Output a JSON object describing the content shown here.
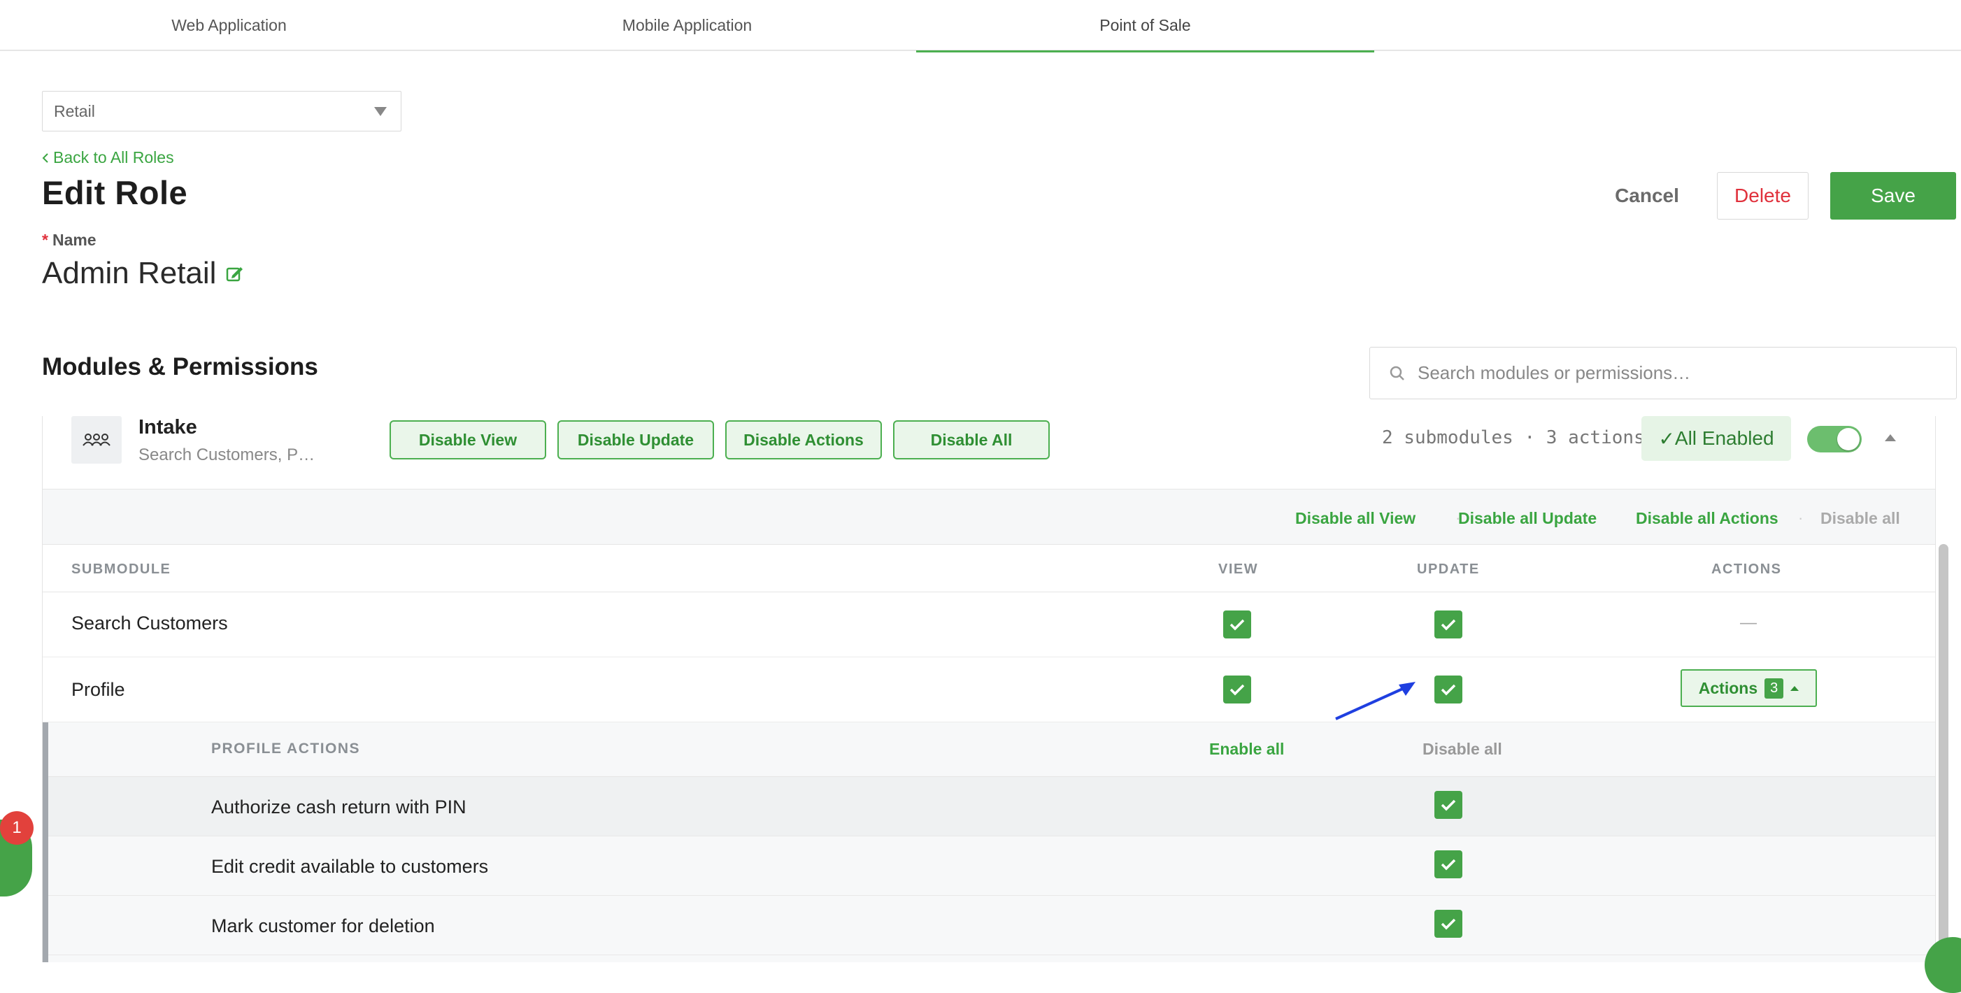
{
  "tabs": [
    {
      "label": "Web Application"
    },
    {
      "label": "Mobile Application"
    },
    {
      "label": "Point of Sale"
    }
  ],
  "store_select": {
    "value": "Retail"
  },
  "back_link": "Back to All Roles",
  "page_title": "Edit Role",
  "header_buttons": {
    "cancel": "Cancel",
    "delete": "Delete",
    "save": "Save"
  },
  "name_field": {
    "label": "Name",
    "required_mark": "*",
    "value": "Admin Retail"
  },
  "section": {
    "title": "Modules & Permissions",
    "search_placeholder": "Search modules or permissions…"
  },
  "module": {
    "name": "Intake",
    "subtitle": "Search Customers, P…",
    "buttons": [
      "Disable View",
      "Disable Update",
      "Disable Actions",
      "Disable All"
    ],
    "meta": "2 submodules · 3 actions",
    "status": "All Enabled",
    "bulk_actions": {
      "view": "Disable all View",
      "update": "Disable all Update",
      "actions": "Disable all Actions",
      "all": "Disable all"
    },
    "columns": {
      "submodule": "SUBMODULE",
      "view": "VIEW",
      "update": "UPDATE",
      "actions": "ACTIONS"
    },
    "rows": [
      {
        "label": "Search Customers",
        "view": true,
        "update": true,
        "actions": "—"
      },
      {
        "label": "Profile",
        "view": true,
        "update": true,
        "actions_label": "Actions",
        "actions_count": "3"
      }
    ],
    "profile_actions": {
      "title": "PROFILE ACTIONS",
      "enable_all": "Enable all",
      "disable_all": "Disable all",
      "items": [
        {
          "label": "Authorize cash return with PIN",
          "checked": true
        },
        {
          "label": "Edit credit available to customers",
          "checked": true
        },
        {
          "label": "Mark customer for deletion",
          "checked": true
        }
      ]
    }
  },
  "chat_badge": "1",
  "colors": {
    "accent": "#45a348",
    "danger": "#e0303b",
    "annotation_arrow": "#1f3fe0"
  },
  "icons": [
    "chevron-left-icon",
    "edit-icon",
    "search-icon",
    "module-group-icon",
    "check-icon",
    "caret-down-icon",
    "caret-up-icon"
  ]
}
